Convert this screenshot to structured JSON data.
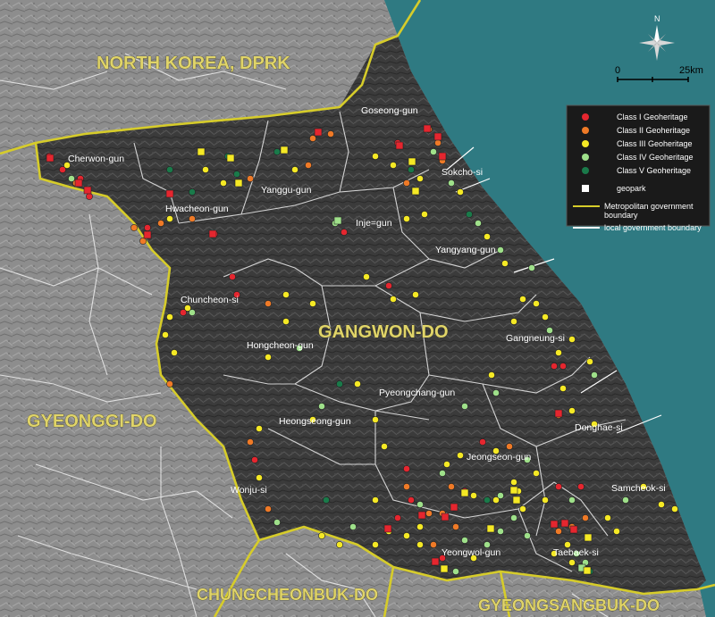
{
  "regions": {
    "north_korea": "NORTH KOREA, DPRK",
    "gangwon": "GANGWON-DO",
    "gyeonggi": "GYEONGGI-DO",
    "chungcheongbuk": "CHUNGCHEONBUK-DO",
    "gyeongsangbuk": "GYEONGSANGBUK-DO"
  },
  "places": [
    "Cherwon-gun",
    "Goseong-gun",
    "Sokcho-si",
    "Yanggu-gun",
    "Hwacheon-gun",
    "Inje=gun",
    "Yangyang-gun",
    "Chuncheon-si",
    "Hongcheon-gun",
    "Gangneung-si",
    "Pyeongchang-gun",
    "Heongseong-gun",
    "Donghae-si",
    "Jeongseon-gun",
    "Wonju-si",
    "Samcheok-si",
    "Yeongwol-gun",
    "Taebaek-si"
  ],
  "north_arrow": {
    "label": "N"
  },
  "scale": {
    "start": "0",
    "end": "25km"
  },
  "legend": {
    "items": [
      {
        "label": "Class I Geoheritage",
        "color": "#e5262f",
        "shape": "circle"
      },
      {
        "label": "Class II Geoheritage",
        "color": "#ef7a27",
        "shape": "circle"
      },
      {
        "label": "Class III Geoheritage",
        "color": "#f5e925",
        "shape": "circle"
      },
      {
        "label": "Class IV Geoheritage",
        "color": "#9fe08a",
        "shape": "circle"
      },
      {
        "label": "Class V Geoheritage",
        "color": "#1a7a4a",
        "shape": "circle"
      },
      {
        "label": "geopark",
        "color": "#ffffff",
        "shape": "square"
      },
      {
        "label": "Metropolitan government boundary",
        "color": "#d6cc2a",
        "shape": "line"
      },
      {
        "label": "local government boundary",
        "color": "#ffffff",
        "shape": "line"
      }
    ]
  },
  "colors": {
    "sea": "#2f7a82",
    "gangwon_fill": "#3a3a3a",
    "outside_fill": "#8a8a8a",
    "metro_boundary": "#d6cc2a",
    "local_boundary": "#ffffff"
  }
}
